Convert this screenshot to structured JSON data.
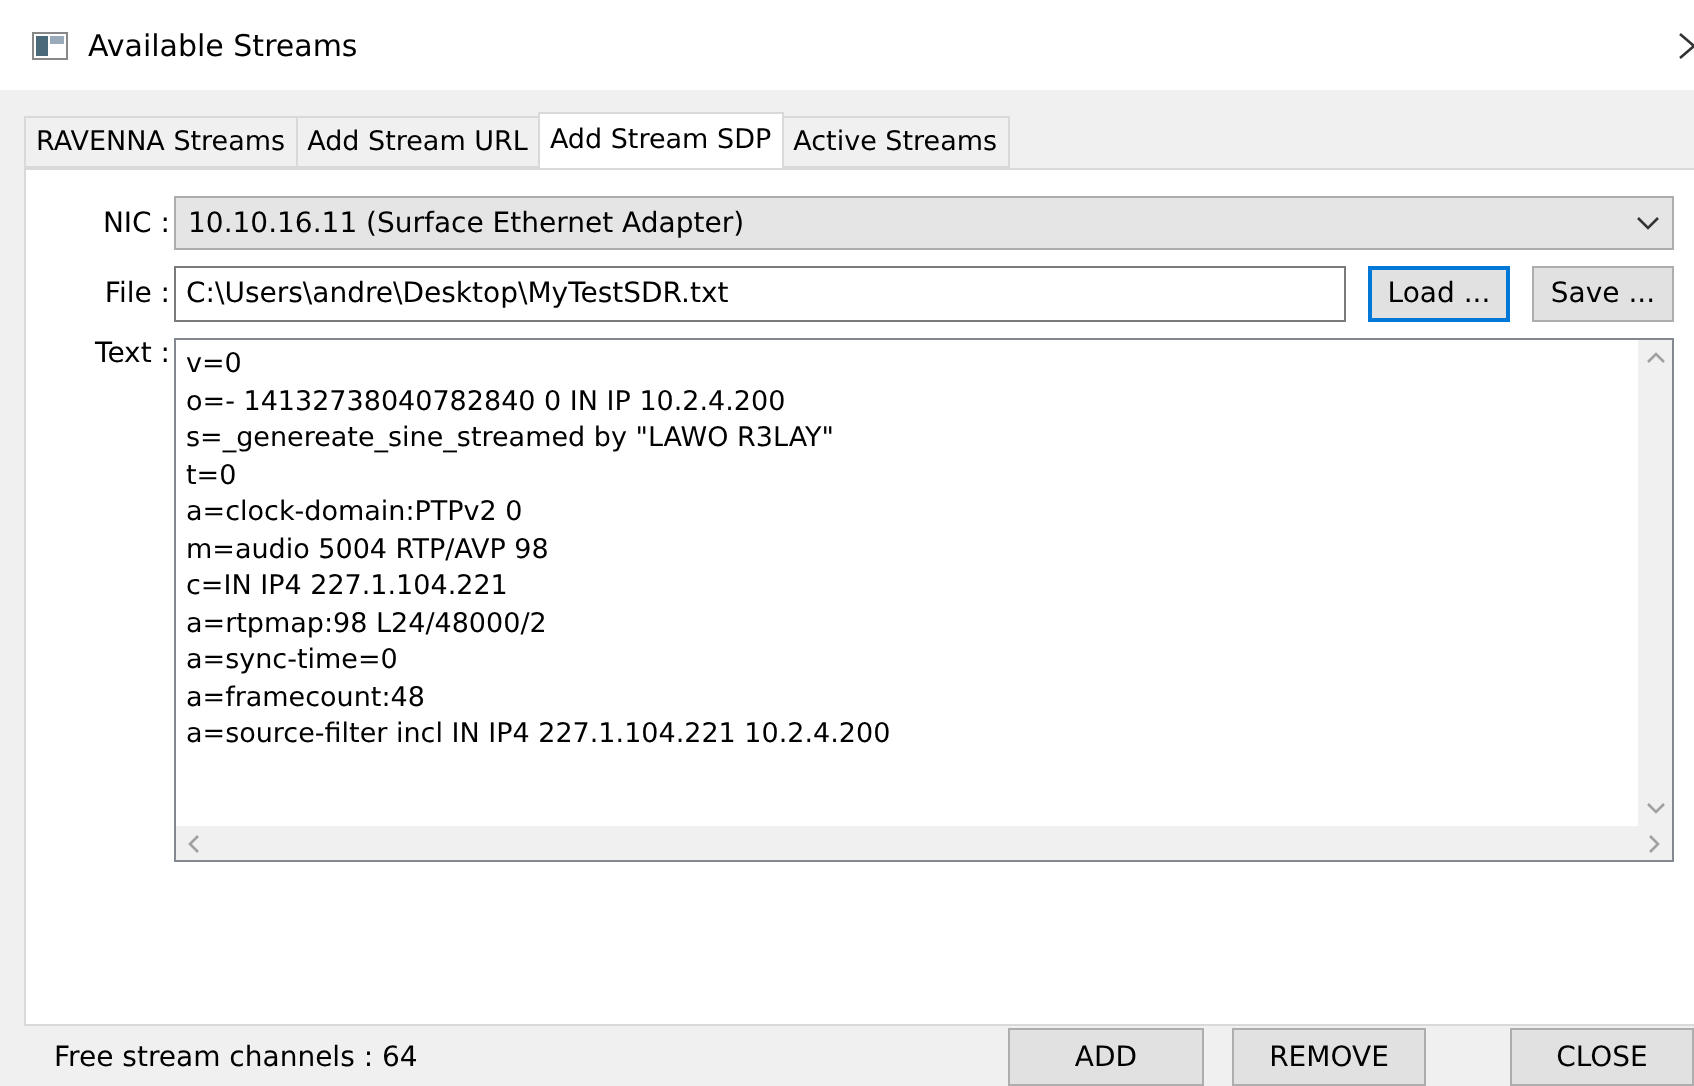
{
  "window": {
    "title": "Available Streams"
  },
  "tabs": [
    {
      "label": "RAVENNA Streams",
      "selected": false
    },
    {
      "label": "Add Stream URL",
      "selected": false
    },
    {
      "label": "Add Stream SDP",
      "selected": true
    },
    {
      "label": "Active Streams",
      "selected": false
    }
  ],
  "nic": {
    "label": "NIC :",
    "value": "10.10.16.11 (Surface Ethernet Adapter)"
  },
  "file": {
    "label": "File :",
    "value": "C:\\Users\\andre\\Desktop\\MyTestSDR.txt",
    "buttons": [
      {
        "label": "Load ...",
        "focused": true
      },
      {
        "label": "Save ...",
        "focused": false
      }
    ]
  },
  "text": {
    "label": "Text :",
    "lines": [
      "v=0",
      "o=- 14132738040782840 0 IN IP 10.2.4.200",
      "s=_genereate_sine_streamed by \"LAWO R3LAY\"",
      "t=0",
      "a=clock-domain:PTPv2 0",
      "m=audio 5004 RTP/AVP 98",
      "c=IN IP4 227.1.104.221",
      "a=rtpmap:98 L24/48000/2",
      "a=sync-time=0",
      "a=framecount:48",
      "a=source-filter incl IN IP4 227.1.104.221 10.2.4.200"
    ]
  },
  "status": "Free stream channels : 64",
  "buttons": [
    "ADD",
    "REMOVE",
    "CLOSE"
  ]
}
